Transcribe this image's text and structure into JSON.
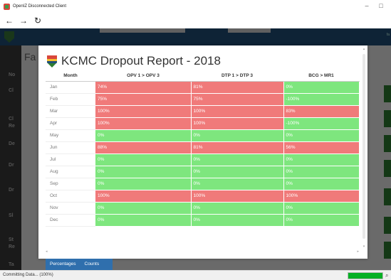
{
  "window": {
    "title": "OpenIZ Disconnected Client",
    "minimize_glyph": "–",
    "maximize_glyph": "□",
    "app_icon": "shield-icon"
  },
  "nav": {
    "back_glyph": "←",
    "forward_glyph": "→",
    "refresh_glyph": "↻"
  },
  "background": {
    "title": "Fa",
    "side_labels": [
      "No",
      "Cl",
      "Cl",
      "Re",
      "De",
      "Dr",
      "Dr",
      "Sl",
      "St",
      "Re",
      "Ta"
    ],
    "right_label": "fa"
  },
  "report": {
    "title": "KCMC Dropout Report - 2018",
    "columns": [
      "Month",
      "OPV 1 > OPV 3",
      "DTP 1 > DTP 3",
      "BCG > MR1"
    ],
    "rows": [
      {
        "month": "Jan",
        "cells": [
          {
            "value": "74%",
            "status": "red"
          },
          {
            "value": "81%",
            "status": "red"
          },
          {
            "value": "0%",
            "status": "green"
          }
        ]
      },
      {
        "month": "Feb",
        "cells": [
          {
            "value": "75%",
            "status": "red"
          },
          {
            "value": "75%",
            "status": "red"
          },
          {
            "value": "-100%",
            "status": "green"
          }
        ]
      },
      {
        "month": "Mar",
        "cells": [
          {
            "value": "100%",
            "status": "red"
          },
          {
            "value": "100%",
            "status": "red"
          },
          {
            "value": "83%",
            "status": "red"
          }
        ]
      },
      {
        "month": "Apr",
        "cells": [
          {
            "value": "100%",
            "status": "red"
          },
          {
            "value": "100%",
            "status": "red"
          },
          {
            "value": "-100%",
            "status": "green"
          }
        ]
      },
      {
        "month": "May",
        "cells": [
          {
            "value": "0%",
            "status": "green"
          },
          {
            "value": "0%",
            "status": "green"
          },
          {
            "value": "0%",
            "status": "green"
          }
        ]
      },
      {
        "month": "Jun",
        "cells": [
          {
            "value": "88%",
            "status": "red"
          },
          {
            "value": "81%",
            "status": "red"
          },
          {
            "value": "56%",
            "status": "red"
          }
        ]
      },
      {
        "month": "Jul",
        "cells": [
          {
            "value": "0%",
            "status": "green"
          },
          {
            "value": "0%",
            "status": "green"
          },
          {
            "value": "0%",
            "status": "green"
          }
        ]
      },
      {
        "month": "Aug",
        "cells": [
          {
            "value": "0%",
            "status": "green"
          },
          {
            "value": "0%",
            "status": "green"
          },
          {
            "value": "0%",
            "status": "green"
          }
        ]
      },
      {
        "month": "Sep",
        "cells": [
          {
            "value": "0%",
            "status": "green"
          },
          {
            "value": "0%",
            "status": "green"
          },
          {
            "value": "0%",
            "status": "green"
          }
        ]
      },
      {
        "month": "Oct",
        "cells": [
          {
            "value": "100%",
            "status": "red"
          },
          {
            "value": "100%",
            "status": "red"
          },
          {
            "value": "100%",
            "status": "red"
          }
        ]
      },
      {
        "month": "Nov",
        "cells": [
          {
            "value": "0%",
            "status": "green"
          },
          {
            "value": "0%",
            "status": "green"
          },
          {
            "value": "0%",
            "status": "green"
          }
        ]
      },
      {
        "month": "Dec",
        "cells": [
          {
            "value": "0%",
            "status": "green"
          },
          {
            "value": "0%",
            "status": "green"
          },
          {
            "value": "0%",
            "status": "green"
          }
        ]
      }
    ],
    "colors": {
      "red": "#f07a7a",
      "green": "#7ee67e"
    }
  },
  "tabs": {
    "percentages": "Percentages",
    "counts": "Counts"
  },
  "status": {
    "text": "Committing Data... (100%)",
    "progress": 1.0,
    "search_glyph": "⌕"
  }
}
